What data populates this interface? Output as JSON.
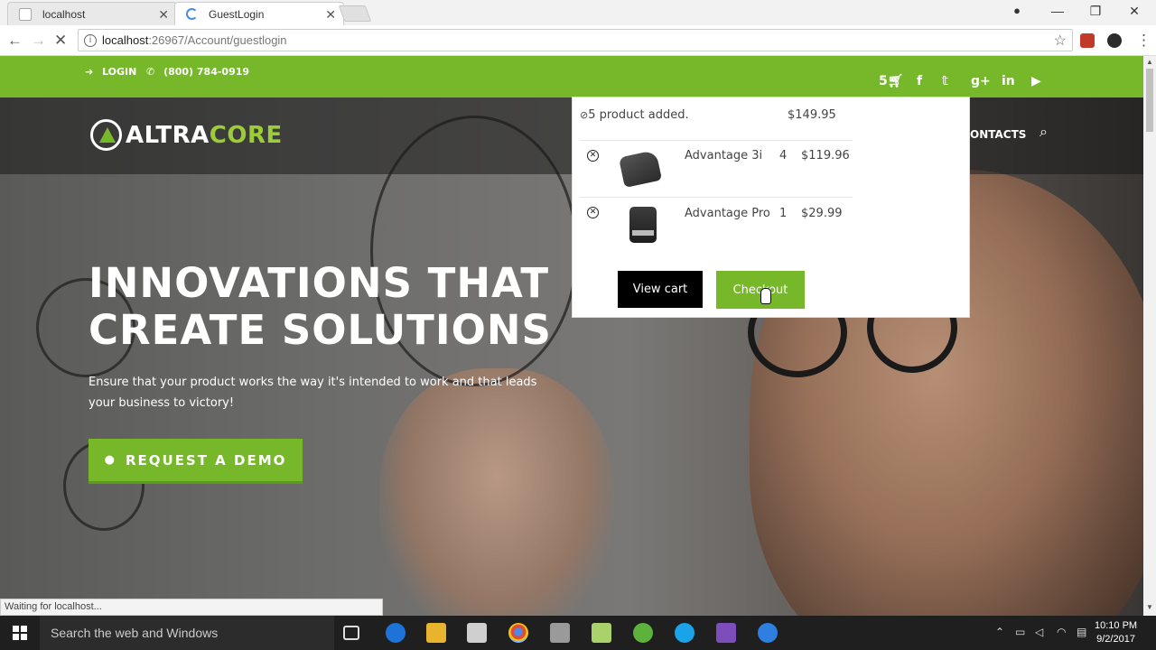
{
  "browser": {
    "tabs": [
      {
        "title": "localhost"
      },
      {
        "title": "GuestLogin"
      }
    ],
    "url_host": "localhost",
    "url_path": ":26967/Account/guestlogin",
    "status_text": "Waiting for localhost..."
  },
  "topbar": {
    "login_label": "LOGIN",
    "phone": "(800) 784-0919",
    "cart_count": "5"
  },
  "header": {
    "logo_part1": "ALTRA",
    "logo_part2": "CORE",
    "nav_visible_text": "ONTACTS"
  },
  "hero": {
    "headline_line1": "INNOVATIONS THAT",
    "headline_line2": "CREATE SOLUTIONS",
    "subtext": "Ensure that your product works the way it's intended to work and that leads your business to victory!",
    "cta_label": "REQUEST A DEMO"
  },
  "cart": {
    "summary": "5 product added.",
    "total": "$149.95",
    "items": [
      {
        "name": "Advantage 3i",
        "qty": "4",
        "price": "$119.96"
      },
      {
        "name": "Advantage Pro",
        "qty": "1",
        "price": "$29.99"
      }
    ],
    "view_cart_label": "View cart",
    "checkout_label": "Checkout"
  },
  "taskbar": {
    "search_placeholder": "Search the web and Windows",
    "time": "10:10 PM",
    "date": "9/2/2017"
  },
  "colors": {
    "brand_green": "#76b82a",
    "dark_overlay": "#191919"
  }
}
